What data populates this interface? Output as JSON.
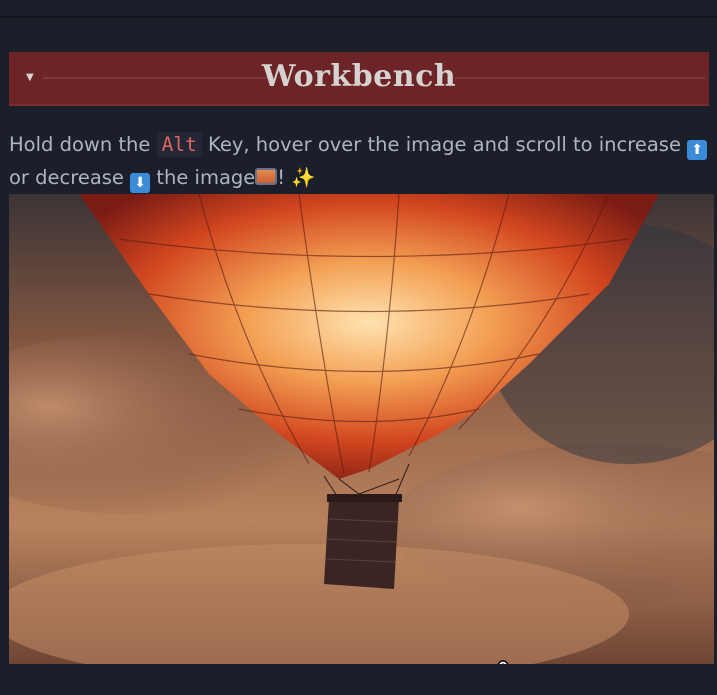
{
  "banner": {
    "title": "Workbench",
    "toggle_icon": "triangle-down-icon"
  },
  "instructions": {
    "part1": "Hold down the ",
    "key": "Alt",
    "part2": " Key, hover over the image and scroll to increase ",
    "part3": " or decrease ",
    "part4": " the image",
    "part5": "! ",
    "up_icon": "arrow-up-emoji-icon",
    "down_icon": "arrow-down-emoji-icon",
    "picture_icon": "framed-picture-emoji-icon",
    "sparkle_icon": "sparkles-emoji-icon"
  },
  "image": {
    "subject": "hot-air-balloon-photo",
    "cursor_icon": "zoom-in-cursor-icon"
  },
  "colors": {
    "background": "#1b1f2a",
    "banner": "#6c2426",
    "key_text": "#e0655c",
    "text": "#aeb4c2"
  }
}
